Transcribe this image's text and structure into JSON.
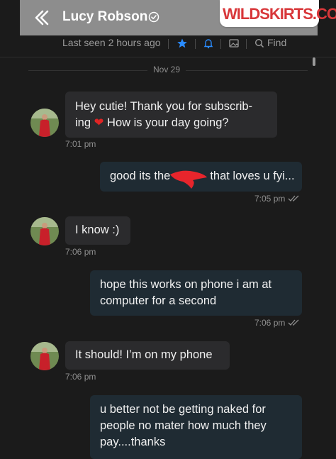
{
  "header": {
    "name": "Lucy Robson",
    "watermark": "WILDSKIRTS.COM",
    "last_seen": "Last seen 2 hours ago",
    "find_label": "Find"
  },
  "chat": {
    "date_separator": "Nov 29",
    "messages": [
      {
        "side": "in",
        "text": "Hey cutie! Thank you for subscrib-\ning",
        "text_tail": " How is your day going?",
        "time": "7:01 pm"
      },
      {
        "side": "out",
        "text": "good its the",
        "text_after_redaction": "that loves u fyi...",
        "time": "7:05 pm"
      },
      {
        "side": "in",
        "text": "I know :)",
        "time": "7:06 pm"
      },
      {
        "side": "out",
        "text": "hope this works on phone i am at\ncomputer for a second",
        "time": "7:06 pm"
      },
      {
        "side": "in",
        "text": "It should! I’m on my phone",
        "time": "7:06 pm"
      },
      {
        "side": "out",
        "text": "u better not be getting naked for\npeople no mater how much they\npay....thanks",
        "time": ""
      }
    ]
  },
  "colors": {
    "header_bg": "#8d8d8d",
    "body_bg": "#1b1b1b",
    "incoming_bubble": "#2b2b2d",
    "outgoing_bubble": "#1f2b33",
    "accent_star": "#2a8cff",
    "redaction": "#e8252c"
  },
  "icons": [
    "back-chevron-icon",
    "verified-check-icon",
    "star-icon",
    "bell-icon",
    "image-icon",
    "search-icon",
    "heart-icon",
    "double-check-icon"
  ]
}
